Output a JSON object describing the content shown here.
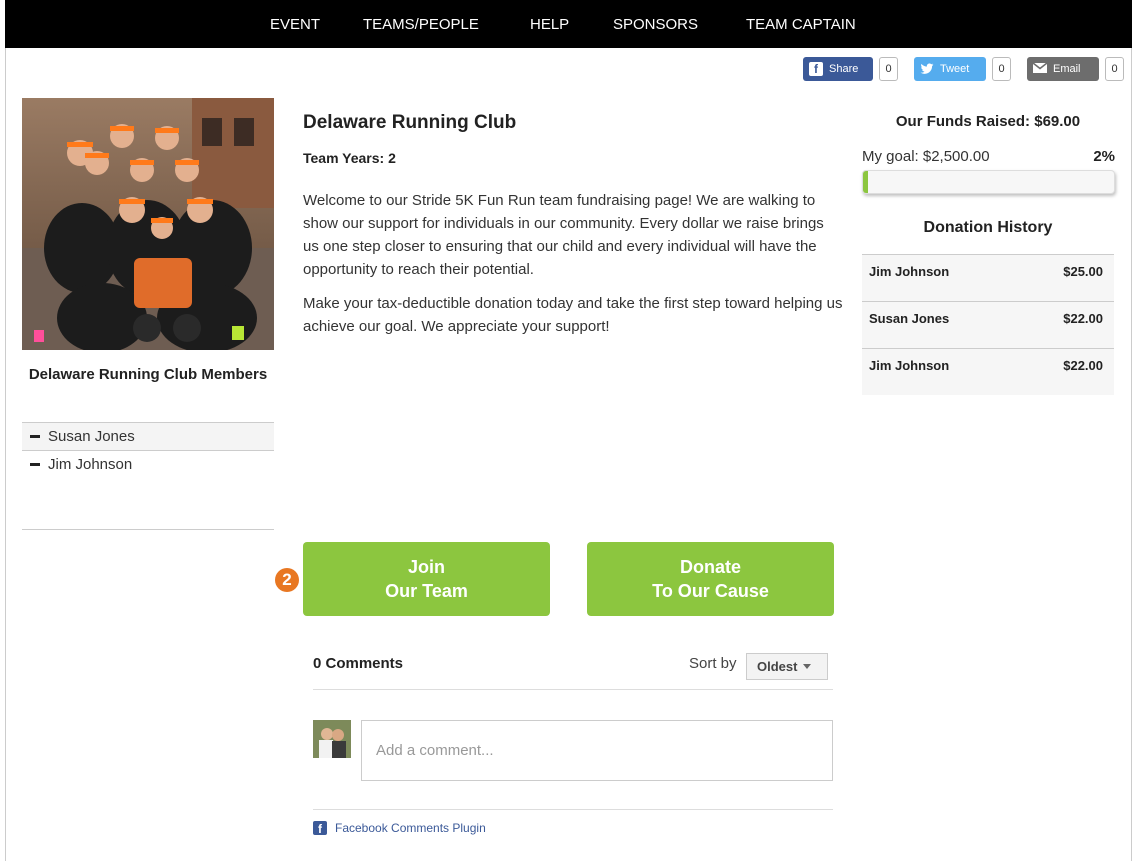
{
  "nav": {
    "items": [
      "EVENT",
      "TEAMS/PEOPLE",
      "HELP",
      "SPONSORS",
      "TEAM CAPTAIN"
    ]
  },
  "share": {
    "facebook": {
      "label": "Share",
      "count": "0"
    },
    "twitter": {
      "label": "Tweet",
      "count": "0"
    },
    "email": {
      "label": "Email",
      "count": "0"
    }
  },
  "team": {
    "name": "Delaware Running Club",
    "years": "Team Years: 2",
    "paragraphs": [
      "Welcome to our Stride 5K Fun Run team fundraising page!  We are walking to show our support for individuals in our community.  Every dollar we raise brings us one step closer to ensuring that our child and every individual will have the opportunity to reach their potential.",
      "Make your tax-deductible donation today and take the first step toward helping us achieve our goal. We appreciate your support!"
    ]
  },
  "members": {
    "title": "Delaware Running Club Members",
    "list": [
      "Susan Jones",
      "Jim Johnson"
    ]
  },
  "actions": {
    "join": {
      "line1": "Join",
      "line2": "Our Team"
    },
    "donate": {
      "line1": "Donate",
      "line2": "To Our Cause"
    },
    "step_badge": "2"
  },
  "comments": {
    "count_label": "0 Comments",
    "sort_label": "Sort by",
    "sort_value": "Oldest",
    "placeholder": "Add a comment...",
    "plugin_label": "Facebook Comments Plugin"
  },
  "funds": {
    "title": "Our Funds Raised: $69.00",
    "goal_label": "My goal: $2,500.00",
    "percent_label": "2%",
    "progress_fraction": 0.02,
    "history_title": "Donation History",
    "history": [
      {
        "name": "Jim Johnson",
        "amount": "$25.00"
      },
      {
        "name": "Susan Jones",
        "amount": "$22.00"
      },
      {
        "name": "Jim Johnson",
        "amount": "$22.00"
      }
    ]
  },
  "colors": {
    "accent_green": "#8cc63f",
    "badge_orange": "#e87722",
    "facebook": "#3b5998",
    "twitter": "#55acee",
    "email": "#6d6d6d"
  }
}
